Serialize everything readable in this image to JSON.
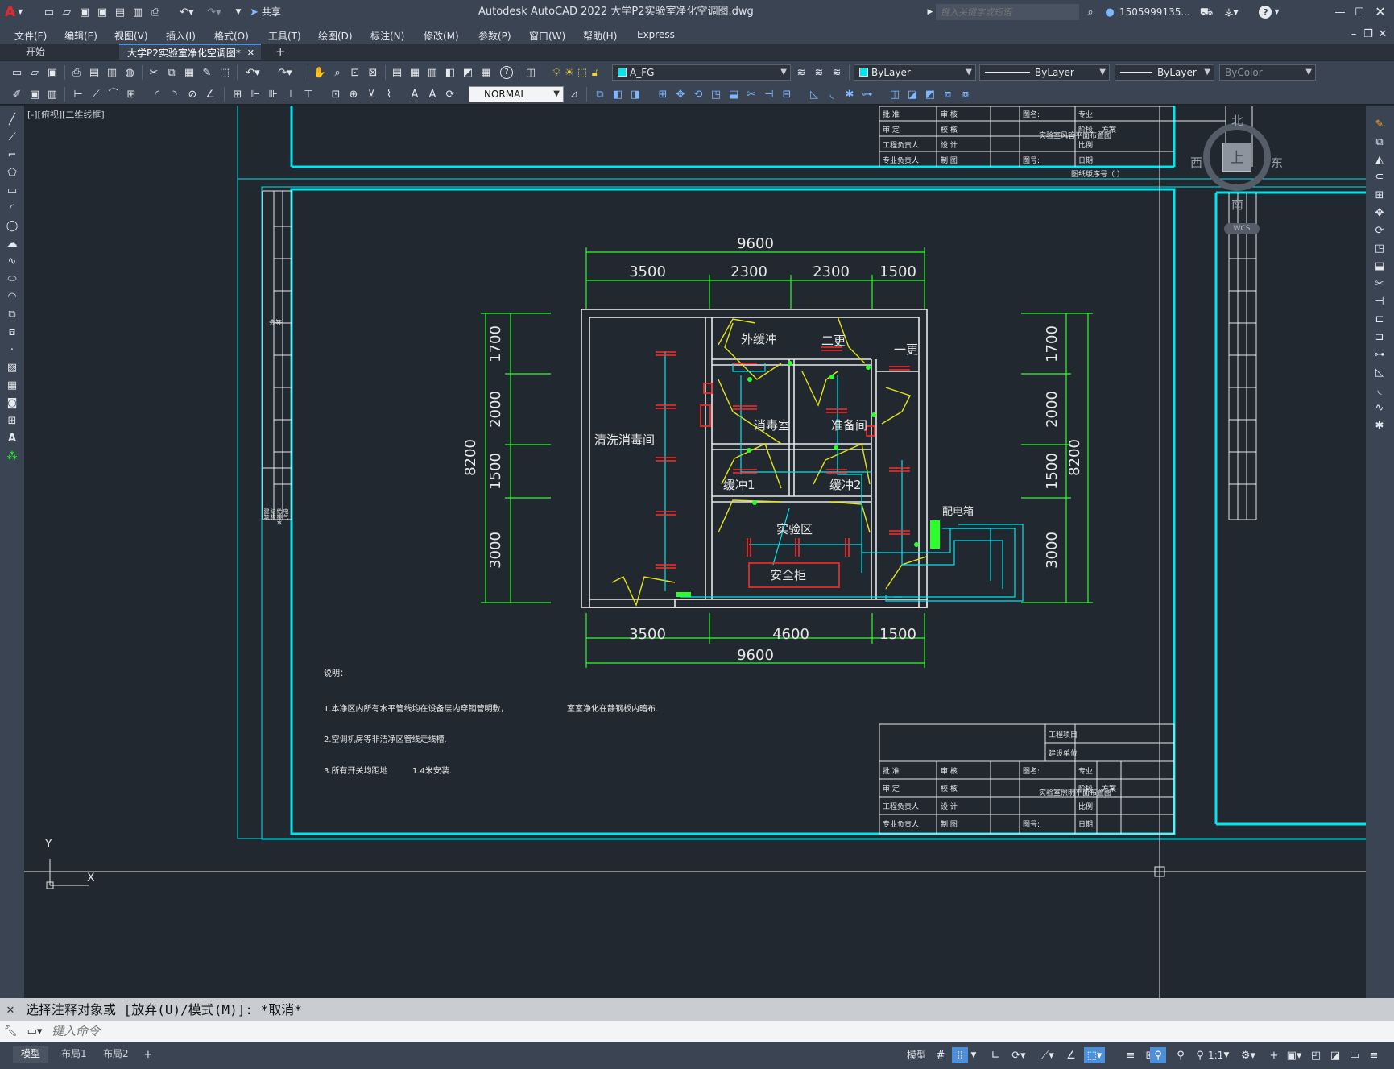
{
  "titlebar": {
    "app_letter": "A",
    "share_label": "共享",
    "title": "Autodesk AutoCAD 2022    大学P2实验室净化空调图.dwg",
    "search_placeholder": "键入关键字或短语",
    "user": "1505999135...",
    "help": "?"
  },
  "menu": [
    "文件(F)",
    "编辑(E)",
    "视图(V)",
    "插入(I)",
    "格式(O)",
    "工具(T)",
    "绘图(D)",
    "标注(N)",
    "修改(M)",
    "参数(P)",
    "窗口(W)",
    "帮助(H)",
    "Express"
  ],
  "file_tabs": [
    {
      "label": "开始"
    },
    {
      "label": "大学P2实验室净化空调图*"
    }
  ],
  "toolbar": {
    "layer_value": "A_FG",
    "color_value": "ByLayer",
    "linetype_value": "ByLayer",
    "lineweight_value": "ByLayer",
    "plotstyle_value": "ByColor",
    "dimstyle_value": "NORMAL"
  },
  "viewport": {
    "label": "[-][俯视][二维线框]"
  },
  "viewcube": {
    "north": "北",
    "south": "南",
    "east": "东",
    "west": "西",
    "top": "上",
    "wcs": "WCS"
  },
  "plan": {
    "rooms": {
      "wash": "清洗消毒间",
      "outer_buffer": "外缓冲",
      "second_change": "二更",
      "first_change": "一更",
      "disinfect": "消毒室",
      "prep": "准备间",
      "buffer1": "缓冲1",
      "buffer2": "缓冲2",
      "lab": "实验区",
      "cabinet": "安全柜",
      "panel": "配电箱"
    },
    "dims": {
      "top_total": "9600",
      "top": [
        "3500",
        "2300",
        "2300",
        "1500"
      ],
      "bottom": [
        "3500",
        "4600",
        "1500"
      ],
      "bottom_total": "9600",
      "left_total": "8200",
      "left": [
        "1700",
        "2000",
        "1500",
        "3000"
      ],
      "right": [
        "1700",
        "2000",
        "1500",
        "3000"
      ],
      "right_total": "8200"
    }
  },
  "notes": {
    "heading": "说明：",
    "n1": "1.本净区内所有水平管线均在设备层内穿钢管明敷，",
    "n1b": "室室净化在静钢板内暗布.",
    "n2": "2.空调机房等非洁净区管线走线槽.",
    "n3": "3.所有开关均距地",
    "n3b": "1.4米安装."
  },
  "titleblock_top": {
    "rows": [
      [
        "批  准",
        "审  核"
      ],
      [
        "审  定",
        "校  核"
      ],
      [
        "工程负责人",
        "设  计"
      ],
      [
        "专业负责人",
        "制  图"
      ]
    ],
    "title_label": "图名:",
    "title": "实验室风管平面布置图",
    "right_labels": [
      "专业",
      "阶段",
      "比例",
      "日期"
    ],
    "right_value": "方案",
    "drawing_no": "图号:",
    "unit_top": "建设单位",
    "footer": "图纸版序号（     ）"
  },
  "titleblock_bottom": {
    "project_label": "工程项目",
    "unit_label": "建设单位",
    "rows": [
      [
        "批  准",
        "审  核"
      ],
      [
        "审  定",
        "校  核"
      ],
      [
        "工程负责人",
        "设  计"
      ],
      [
        "专业负责人",
        "制  图"
      ]
    ],
    "title_label": "图名:",
    "title": "实验室照明平面布置图",
    "right_labels": [
      "专业",
      "阶段",
      "比例",
      "日期"
    ],
    "right_value": "方案",
    "drawing_no": "图号:"
  },
  "side_stamp": {
    "label": "会签",
    "cols": [
      "建筑",
      "结构",
      "给排水",
      "电气",
      "暖通"
    ]
  },
  "command": {
    "history": "选择注释对象或 [放弃(U)/模式(M)]: *取消*",
    "placeholder": "键入命令"
  },
  "layout_tabs": [
    "模型",
    "布局1",
    "布局2"
  ],
  "status": {
    "model_label": "模型",
    "scale": "1:1"
  },
  "colors": {
    "background": "#212830",
    "cyan": "#00e5ee",
    "green": "#2bff2b",
    "yellow": "#e3e31a",
    "red": "#ff2a2a",
    "white": "#e8e8e8",
    "ui_bar": "#3b4453"
  }
}
